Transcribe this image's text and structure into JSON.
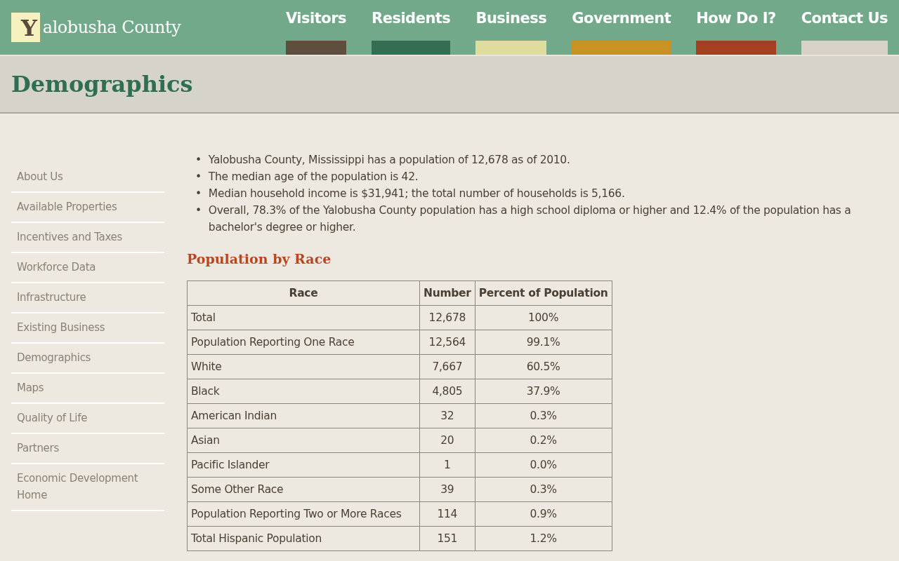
{
  "logo": {
    "initial": "Y",
    "rest": "alobusha County"
  },
  "nav": [
    {
      "label": "Visitors",
      "color": "#5e4e3d"
    },
    {
      "label": "Residents",
      "color": "#336e52"
    },
    {
      "label": "Business",
      "color": "#e0dca0"
    },
    {
      "label": "Government",
      "color": "#c89322"
    },
    {
      "label": "How Do I?",
      "color": "#a53f22"
    },
    {
      "label": "Contact Us",
      "color": "#d8d1c7"
    }
  ],
  "page_title": "Demographics",
  "sidebar": {
    "items": [
      "About Us",
      "Available Properties",
      "Incentives and Taxes",
      "Workforce Data",
      "Infrastructure",
      "Existing Business",
      "Demographics",
      "Maps",
      "Quality of Life",
      "Partners",
      "Economic Development Home"
    ]
  },
  "facts": [
    {
      "marker": "•",
      "text": "Yalobusha County, Mississippi has a population of 12,678 as of 2010."
    },
    {
      "marker": "•",
      "text": "The median age of the population is 42."
    },
    {
      "marker": "•",
      "text": "Median household income is $31,941; the total number of households is 5,166."
    },
    {
      "marker": "•",
      "text": "Overall, 78.3% of the Yalobusha County population has a high school diploma or higher and 12.4% of the population has a bachelor's degree or higher."
    }
  ],
  "section_title": "Population by Race",
  "table": {
    "columns": [
      "Race",
      "Number",
      "Percent of Population"
    ],
    "rows": [
      [
        "Total",
        "12,678",
        "100%"
      ],
      [
        "Population Reporting One Race",
        "12,564",
        "99.1%"
      ],
      [
        "White",
        "7,667",
        "60.5%"
      ],
      [
        "Black",
        "4,805",
        "37.9%"
      ],
      [
        "American Indian",
        "32",
        "0.3%"
      ],
      [
        "Asian",
        "20",
        "0.2%"
      ],
      [
        "Pacific Islander",
        "1",
        "0.0%"
      ],
      [
        "Some Other Race",
        "39",
        "0.3%"
      ],
      [
        "Population Reporting Two or More Races",
        "114",
        "0.9%"
      ],
      [
        "Total Hispanic Population",
        "151",
        "1.2%"
      ]
    ]
  }
}
